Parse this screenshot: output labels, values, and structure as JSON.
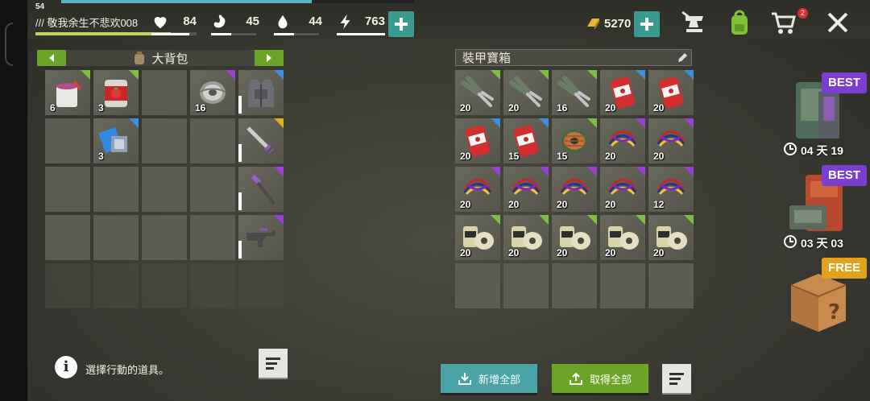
{
  "player": {
    "level": "54",
    "name": "/// 敬我余生不悲欢008",
    "name_bar_fill": 0.84
  },
  "xp_fill": 0.71,
  "stats": [
    {
      "name": "health",
      "icon": "heart-icon",
      "value": "84",
      "fill": 0.84
    },
    {
      "name": "food",
      "icon": "stomach-icon",
      "value": "45",
      "fill": 0.45
    },
    {
      "name": "water",
      "icon": "water-drop-icon",
      "value": "44",
      "fill": 0.44
    },
    {
      "name": "energy",
      "icon": "lightning-icon",
      "value": "763",
      "fill": 1.0
    }
  ],
  "gold": {
    "value": "5270",
    "icon": "gold-bar-icon"
  },
  "cart_badge": "2",
  "backpack": {
    "title": "大背包",
    "left_arrow": "prev-bag-arrow",
    "right_arrow": "next-bag-arrow",
    "items": [
      {
        "slot": 0,
        "icon": "paint-bucket-icon",
        "count": "6",
        "rarity": "#7ac143"
      },
      {
        "slot": 1,
        "icon": "tomato-can-icon",
        "count": "3",
        "rarity": "#7ac143"
      },
      {
        "slot": 3,
        "icon": "wire-coil-icon",
        "count": "16",
        "rarity": "#9b3fd6"
      },
      {
        "slot": 5,
        "icon": "blue-tape-icon",
        "count": "3",
        "rarity": "#3f8fe0"
      }
    ],
    "equipment": [
      {
        "icon": "armor-vest-icon",
        "rarity": "#3f8fe0"
      },
      {
        "icon": "sword-icon",
        "rarity": "#e0b020"
      },
      {
        "icon": "purple-staff-icon",
        "rarity": "#9b3fd6"
      },
      {
        "icon": "rifle-icon",
        "rarity": "#9b3fd6"
      }
    ]
  },
  "chest": {
    "title": "裝甲寶箱",
    "items": [
      {
        "icon": "pliers-icon",
        "count": "20",
        "rarity": "#7ac143"
      },
      {
        "icon": "pliers-icon",
        "count": "20",
        "rarity": "#7ac143"
      },
      {
        "icon": "pliers-icon",
        "count": "16",
        "rarity": "#7ac143"
      },
      {
        "icon": "red-can-icon",
        "count": "20",
        "rarity": "#3f8fe0"
      },
      {
        "icon": "red-can-icon",
        "count": "20",
        "rarity": "#3f8fe0"
      },
      {
        "icon": "red-can-icon",
        "count": "20",
        "rarity": "#3f8fe0"
      },
      {
        "icon": "red-can-icon",
        "count": "15",
        "rarity": "#3f8fe0"
      },
      {
        "icon": "copper-coil-icon",
        "count": "15",
        "rarity": "#7ac143"
      },
      {
        "icon": "cables-icon",
        "count": "20",
        "rarity": "#9b3fd6"
      },
      {
        "icon": "cables-icon",
        "count": "20",
        "rarity": "#9b3fd6"
      },
      {
        "icon": "cables-icon",
        "count": "20",
        "rarity": "#9b3fd6"
      },
      {
        "icon": "cables-icon",
        "count": "20",
        "rarity": "#9b3fd6"
      },
      {
        "icon": "cables-icon",
        "count": "20",
        "rarity": "#9b3fd6"
      },
      {
        "icon": "cables-icon",
        "count": "20",
        "rarity": "#9b3fd6"
      },
      {
        "icon": "cables-icon",
        "count": "12",
        "rarity": "#9b3fd6"
      },
      {
        "icon": "film-roll-icon",
        "count": "20",
        "rarity": "#7ac143"
      },
      {
        "icon": "film-roll-icon",
        "count": "20",
        "rarity": "#7ac143"
      },
      {
        "icon": "film-roll-icon",
        "count": "20",
        "rarity": "#7ac143"
      },
      {
        "icon": "film-roll-icon",
        "count": "20",
        "rarity": "#7ac143"
      },
      {
        "icon": "film-roll-icon",
        "count": "20",
        "rarity": "#7ac143"
      }
    ]
  },
  "info_text": "選擇行動的道具。",
  "buttons": {
    "add_all": "新增全部",
    "take_all": "取得全部"
  },
  "offers": [
    {
      "tag": "BEST",
      "timer": "04 天 19",
      "tag_color": "#7a3fd0"
    },
    {
      "tag": "BEST",
      "timer": "03 天 03",
      "tag_color": "#7a3fd0"
    },
    {
      "tag": "FREE",
      "tag_color": "#e0a21a"
    }
  ],
  "colors": {
    "accent_teal": "#3a9a8f",
    "green_button": "#6aa528",
    "teal_button": "#4aa3a6"
  }
}
